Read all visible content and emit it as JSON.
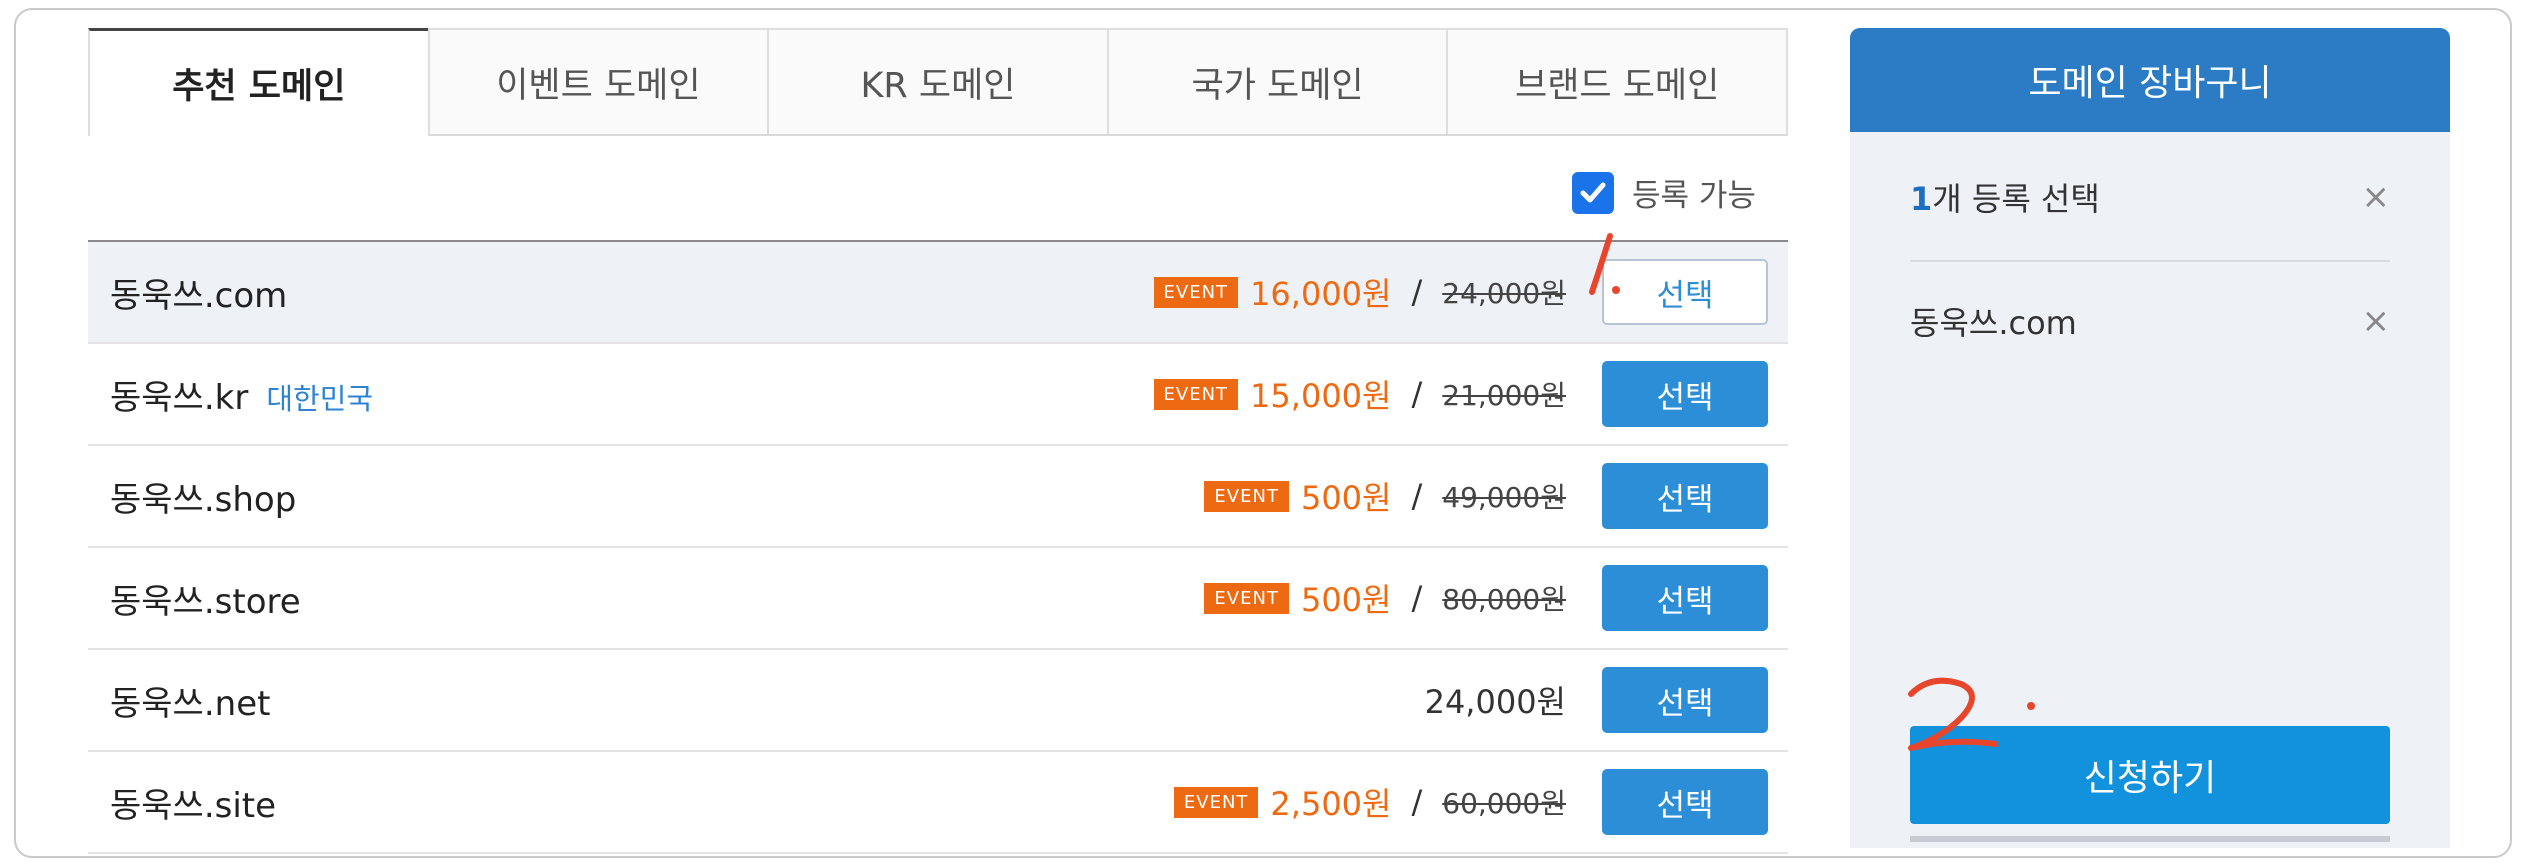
{
  "tabs": [
    "추천 도메인",
    "이벤트 도메인",
    "KR 도메인",
    "국가 도메인",
    "브랜드 도메인"
  ],
  "filter": {
    "label": "등록 가능",
    "checked": true
  },
  "list": [
    {
      "domain": "동욱쓰.com",
      "badge": "EVENT",
      "price": "16,000원",
      "original": "24,000원",
      "select": "선택",
      "selected": true
    },
    {
      "domain": "동욱쓰.kr",
      "country": "대한민국",
      "badge": "EVENT",
      "price": "15,000원",
      "original": "21,000원",
      "select": "선택"
    },
    {
      "domain": "동욱쓰.shop",
      "badge": "EVENT",
      "price": "500원",
      "original": "49,000원",
      "select": "선택"
    },
    {
      "domain": "동욱쓰.store",
      "badge": "EVENT",
      "price": "500원",
      "original": "80,000원",
      "select": "선택"
    },
    {
      "domain": "동욱쓰.net",
      "price": "24,000원",
      "select": "선택"
    },
    {
      "domain": "동욱쓰.site",
      "badge": "EVENT",
      "price": "2,500원",
      "original": "60,000원",
      "select": "선택"
    }
  ],
  "separator": "/",
  "cart": {
    "title": "도메인 장바구니",
    "count": "1",
    "count_suffix": "개 등록 선택",
    "items": [
      "동욱쓰.com"
    ],
    "close_icon": "×",
    "apply": "신청하기"
  },
  "annotations": {
    "one": "1.",
    "two": "2."
  },
  "colors": {
    "accent": "#2b7cc4",
    "event": "#ee6a12",
    "annotation": "#e8462c"
  }
}
